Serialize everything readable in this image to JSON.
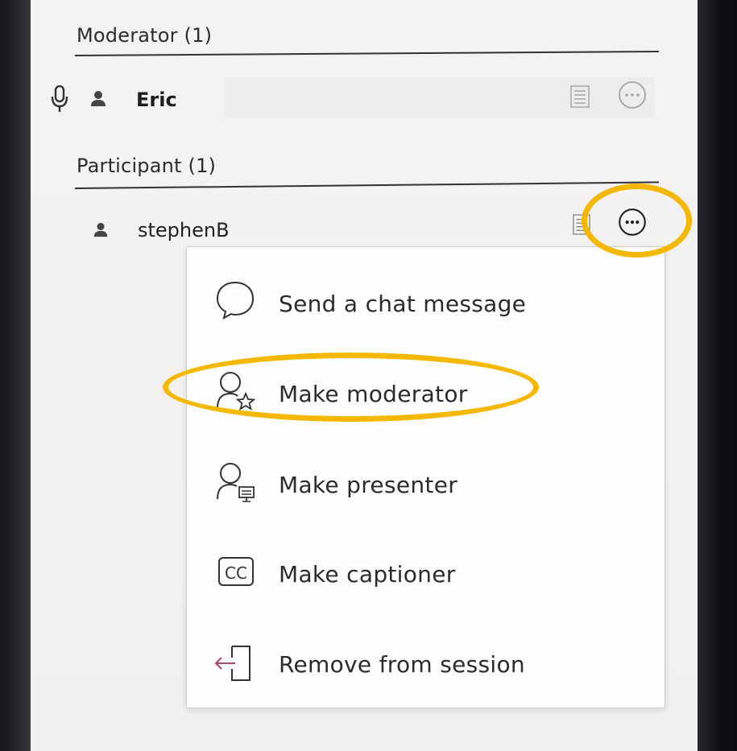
{
  "moderators": {
    "header": "Moderator (1)",
    "items": [
      {
        "name": "Eric"
      }
    ]
  },
  "participants": {
    "header": "Participant (1)",
    "items": [
      {
        "name": "stephenB"
      }
    ]
  },
  "context_menu": {
    "items": [
      {
        "label": "Send a chat message",
        "icon": "chat-bubble-icon"
      },
      {
        "label": "Make moderator",
        "icon": "user-star-icon"
      },
      {
        "label": "Make presenter",
        "icon": "user-presenter-icon"
      },
      {
        "label": "Make captioner",
        "icon": "closed-caption-icon"
      },
      {
        "label": "Remove from session",
        "icon": "exit-session-icon"
      }
    ]
  },
  "colors": {
    "highlight": "#f5b800",
    "text": "#2b2b2b",
    "remove_icon_accent": "#a64a6a"
  }
}
